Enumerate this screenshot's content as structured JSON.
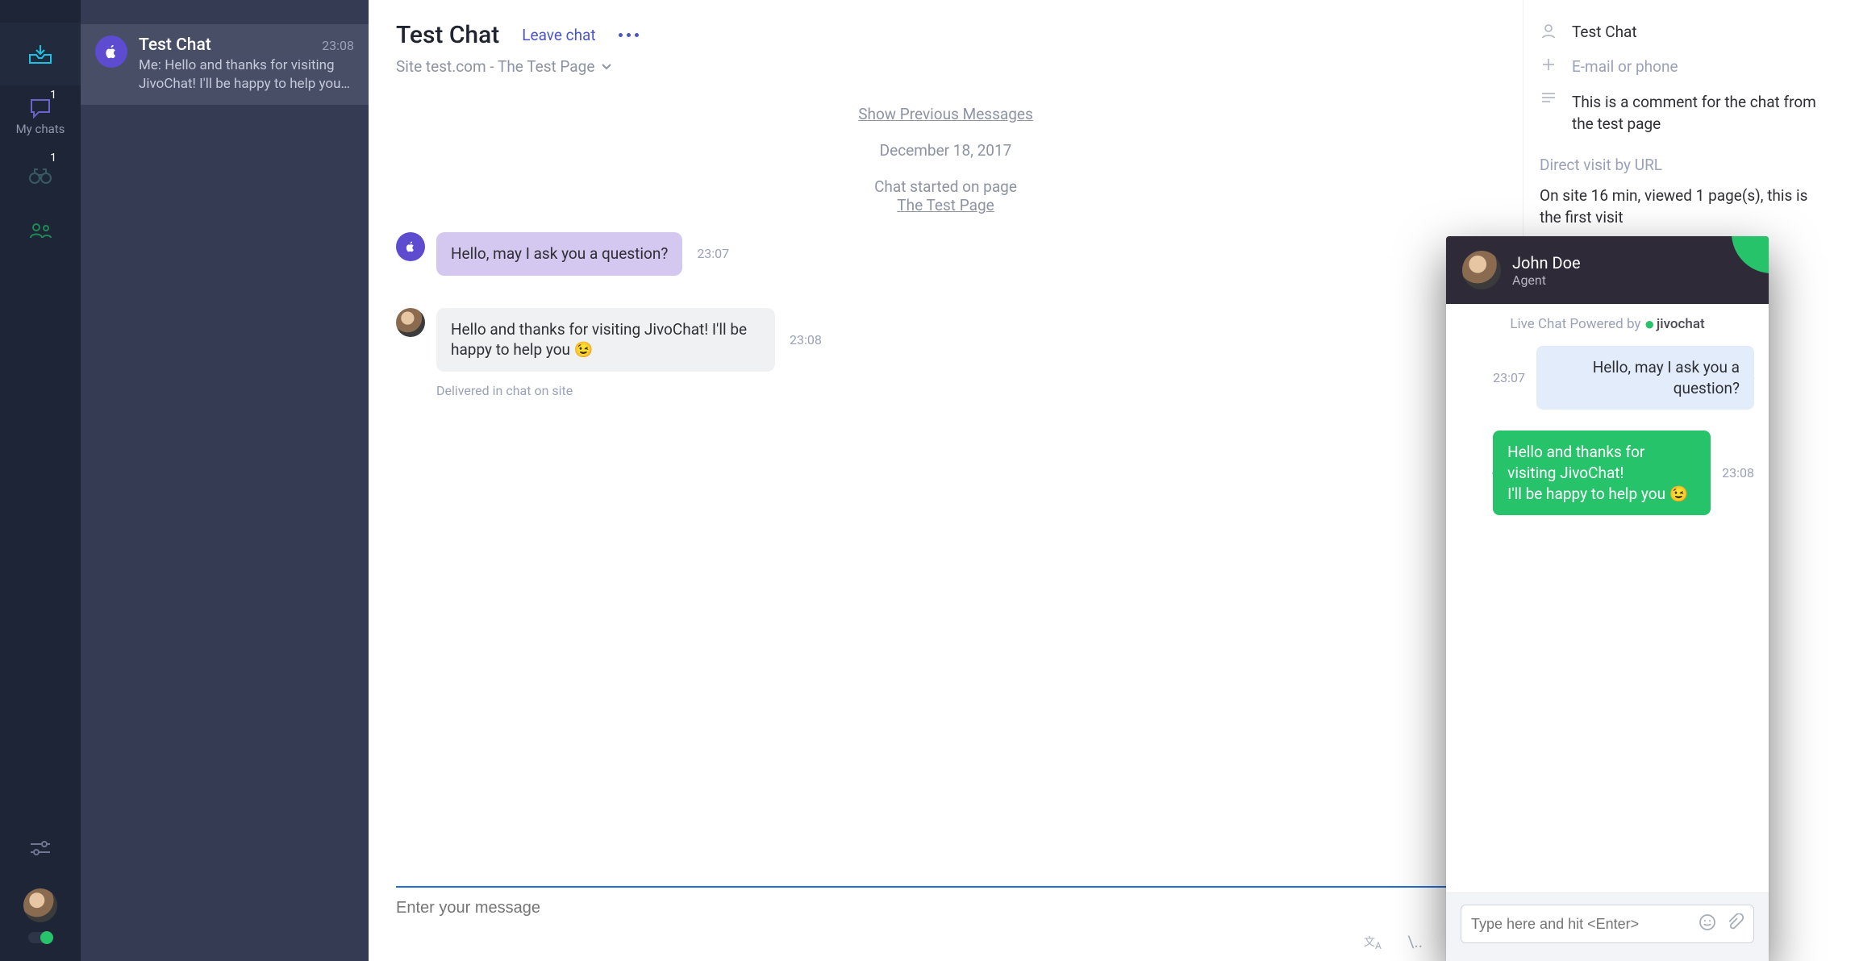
{
  "nav": {
    "mychats_label": "My chats",
    "mychats_badge": "1",
    "visitors_badge": "1"
  },
  "chats": [
    {
      "title": "Test Chat",
      "time": "23:08",
      "preview": "Me: Hello and thanks for visiting JivoChat! I'll be happy to help you…"
    }
  ],
  "conversation": {
    "title": "Test Chat",
    "leave_label": "Leave chat",
    "source_line": "Site test.com - The Test Page",
    "show_previous": "Show Previous Messages",
    "date_separator": "December 18, 2017",
    "started_label": "Chat started on page",
    "started_page": "The Test Page",
    "messages": [
      {
        "side": "visitor",
        "text": "Hello, may I ask you a question?",
        "time": "23:07"
      },
      {
        "side": "agent",
        "text": "Hello and thanks for visiting JivoChat! I'll be happy to help you 😉",
        "time": "23:08"
      }
    ],
    "delivery_status": "Delivered in chat on site",
    "compose_placeholder": "Enter your message"
  },
  "details": {
    "name": "Test Chat",
    "contact_placeholder": "E-mail or phone",
    "comment": "This is a comment for the chat from the test page",
    "visit_source": "Direct visit by URL",
    "visit_stats": "On site 16 min, viewed 1 page(s), this is the first visit"
  },
  "widget": {
    "agent_name": "John Doe",
    "agent_role": "Agent",
    "powered_prefix": "Live Chat Powered by ",
    "powered_brand": "jivochat",
    "messages": [
      {
        "side": "visitor",
        "text": "Hello, may I ask you a question?",
        "time": "23:07"
      },
      {
        "side": "agent",
        "text": "Hello and thanks for visiting JivoChat!\nI'll be happy to help you 😉",
        "time": "23:08"
      }
    ],
    "compose_placeholder": "Type here and hit <Enter>"
  }
}
